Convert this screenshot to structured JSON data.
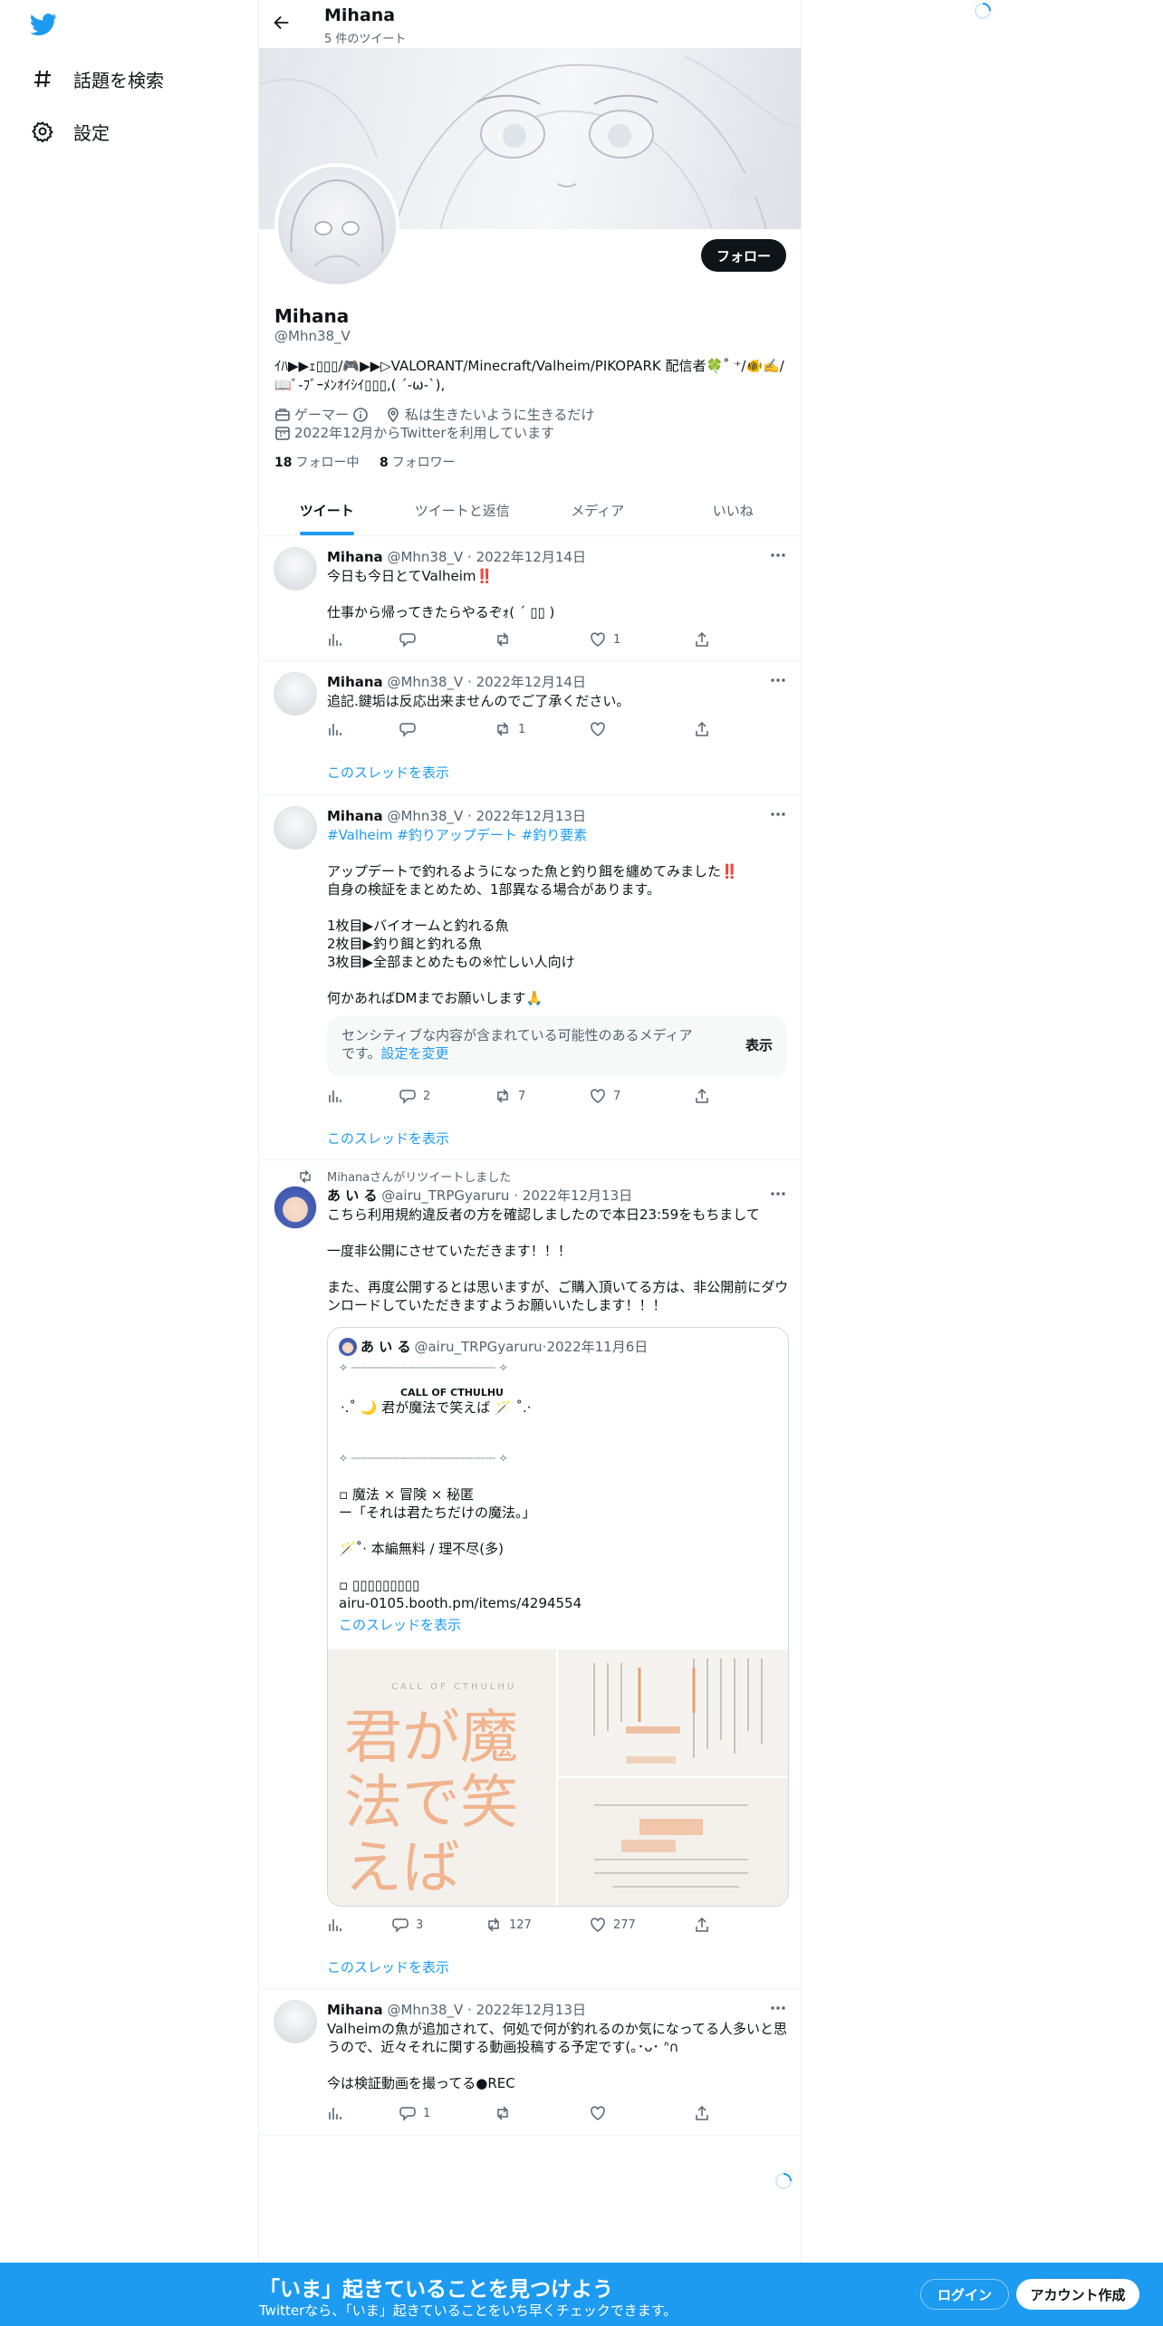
{
  "nav": {
    "items": [
      {
        "label": "話題を検索",
        "icon": "hashtag-icon"
      },
      {
        "label": "設定",
        "icon": "gear-icon"
      }
    ]
  },
  "header": {
    "name": "Mihana",
    "count": "5 件のツイート"
  },
  "profile": {
    "name": "Mihana",
    "handle": "@Mhn38_V",
    "follow_label": "フォロー",
    "bio_line1": "ｲﾊ▶︎▶︎ｪ︎▯▯▯/🎮▶︎▶︎▷VALORANT/Minecraft/Valheim/PIKOPARK 配信者🍀˚ ⁺/🐠✍️/",
    "bio_line2": "📖ﾞ-ﾌﾞｰﾒﾝｵｲｼｲ▯▯▯,( ´-ω-`),",
    "category": "ゲーマー",
    "location": "私は生きたいように生きるだけ",
    "joined": "2022年12月からTwitterを利用しています",
    "following_count": "18",
    "following_label": "フォロー中",
    "followers_count": "8",
    "followers_label": "フォロワー"
  },
  "tabs": [
    {
      "label": "ツイート",
      "active": true
    },
    {
      "label": "ツイートと返信",
      "active": false
    },
    {
      "label": "メディア",
      "active": false
    },
    {
      "label": "いいね",
      "active": false
    }
  ],
  "tweets": [
    {
      "name": "Mihana",
      "handle": "@Mhn38_V",
      "date": "2022年12月14日",
      "text": "今日も今日とてValheim‼️\n\n仕事から帰ってきたらやるぞｫ( ´ ▯▯ )",
      "replies": "",
      "retweets": "",
      "likes": "1"
    },
    {
      "name": "Mihana",
      "handle": "@Mhn38_V",
      "date": "2022年12月14日",
      "text": "追記.鍵垢は反応出来ませんのでご了承ください。",
      "replies": "",
      "retweets": "1",
      "likes": "",
      "thread_label": "このスレッドを表示"
    },
    {
      "name": "Mihana",
      "handle": "@Mhn38_V",
      "date": "2022年12月13日",
      "hashtags": "#Valheim #釣りアップデート #釣り要素",
      "text": "アップデートで釣れるようになった魚と釣り餌を纏めてみました‼️\n自身の検証をまとめため、1部異なる場合があります。\n\n1枚目▶︎バイオームと釣れる魚\n2枚目▶︎釣り餌と釣れる魚\n3枚目▶︎全部まとめたもの※忙しい人向け\n\n何かあればDMまでお願いします🙏",
      "sensitive_text": "センシティブな内容が含まれている可能性のあるメディアです。",
      "sensitive_link": "設定を変更",
      "sensitive_button": "表示",
      "replies": "2",
      "retweets": "7",
      "likes": "7",
      "thread_label": "このスレッドを表示"
    },
    {
      "retweet_label": "Mihanaさんがリツイートしました",
      "name": "あ い る",
      "handle": "@airu_TRPGyaruru",
      "date": "2022年12月13日",
      "text": "こちら利用規約違反者の方を確認しましたので本日23:59をもちまして\n\n一度非公開にさせていただきます！！！\n\nまた、再度公開するとは思いますが、ご購入頂いてる方は、非公開前にダウンロードしていただきますようお願いいたします！！！",
      "quote": {
        "name": "あ い る",
        "handle": "@airu_TRPGyaruru",
        "date": "2022年11月6日",
        "line1": "✧ ┈┈┈┈┈┈┈┈┈┈┈┈┈┈┈┈┈┈┈┈┈┈ ✧",
        "line2": "CALL OF CTHULHU",
        "line3": "·.˚ 🌙 君が魔法で笑えば 🪄 ˚.·",
        "line4": "✧ ┈┈┈┈┈┈┈┈┈┈┈┈┈┈┈┈┈┈┈┈┈┈ ✧",
        "line5": "▫︎ 魔法 × 冒険 × 秘匿",
        "line6": "ー「それは君たちだけの魔法。」",
        "line7": "🪄˚‧ 本編無料 / 理不尽(多)",
        "line8": "▫︎ ▯▯▯▯▯▯▯▯▯",
        "url": "airu-0105.booth.pm/items/4294554",
        "thread_label": "このスレッドを表示",
        "image_title": "君が魔法で笑えば",
        "image_subtitle": "CALL OF CTHULHU"
      },
      "replies": "3",
      "retweets": "127",
      "likes": "277",
      "thread_label": "このスレッドを表示"
    },
    {
      "name": "Mihana",
      "handle": "@Mhn38_V",
      "date": "2022年12月13日",
      "text": "Valheimの魚が追加されて、何処で何が釣れるのか気になってる人多いと思うので、近々それに関する動画投稿する予定です(｡･ᴗ･ ᐢ∩\n\n今は検証動画を撮ってる●REC",
      "replies": "1",
      "retweets": "",
      "likes": ""
    }
  ],
  "bottom": {
    "title": "「いま」起きていることを見つけよう",
    "subtitle": "Twitterなら、「いま」起きていることをいち早くチェックできます。",
    "login": "ログイン",
    "signup": "アカウント作成"
  },
  "colors": {
    "accent": "#1d9bf0",
    "text": "#0f1419",
    "muted": "#536471"
  }
}
